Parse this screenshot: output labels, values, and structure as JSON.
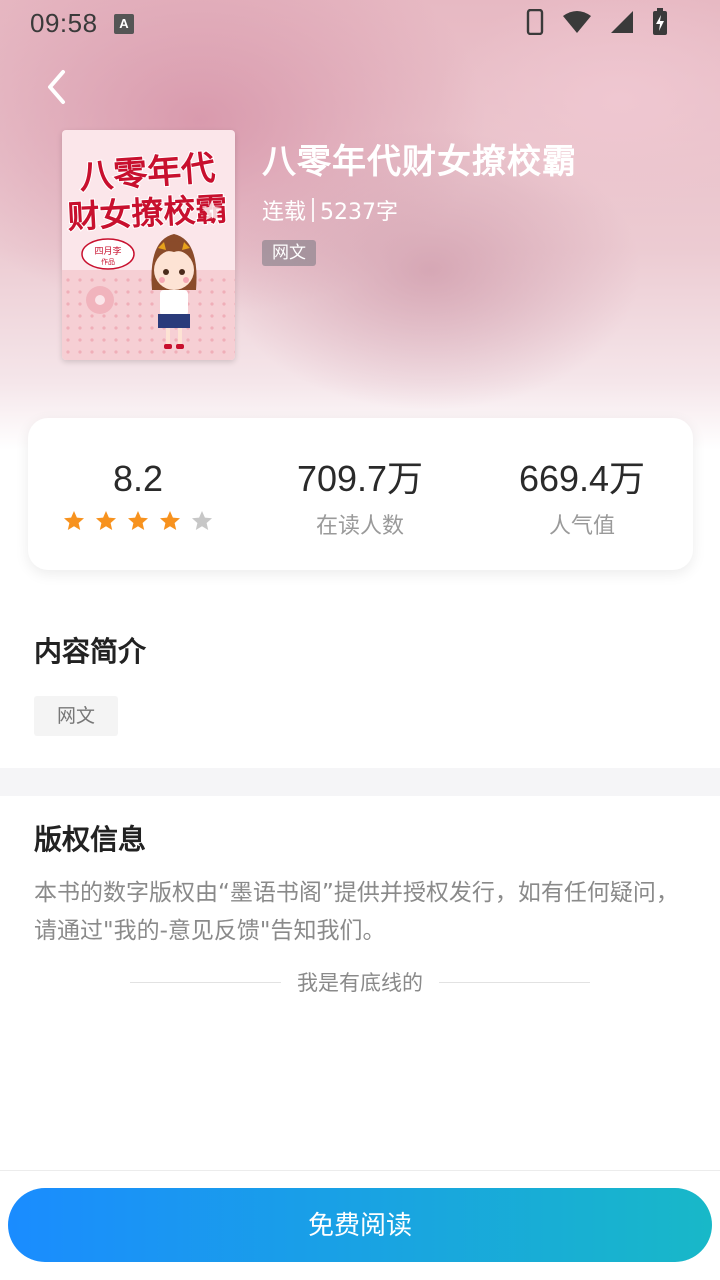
{
  "status_bar": {
    "time": "09:58",
    "notification_glyph": "A"
  },
  "book": {
    "title": "八零年代财女撩校霸",
    "status": "连载",
    "word_count": "5237字",
    "tag": "网文",
    "cover": {
      "title_line1": "八零年代",
      "title_line2": "财女撩校霸",
      "author_badge_line1": "四月李",
      "author_badge_line2": "作品"
    }
  },
  "stats": {
    "rating": "8.2",
    "rating_stars": 4,
    "rating_stars_max": 5,
    "readers_value": "709.7万",
    "readers_label": "在读人数",
    "popularity_value": "669.4万",
    "popularity_label": "人气值"
  },
  "intro": {
    "title": "内容简介",
    "tag": "网文"
  },
  "copyright": {
    "title": "版权信息",
    "text": "本书的数字版权由“墨语书阁”提供并授权发行，如有任何疑问，请通过\"我的-意见反馈\"告知我们。",
    "bottom_line": "我是有底线的"
  },
  "actions": {
    "read_button": "免费阅读"
  },
  "colors": {
    "star_active": "#f7921e",
    "star_inactive": "#c7c7c7",
    "button_gradient_start": "#1a8cff",
    "button_gradient_end": "#18b8c8"
  },
  "icons": {
    "back": "chevron-left-icon",
    "phone": "phone-icon",
    "wifi": "wifi-icon",
    "signal": "signal-icon",
    "battery": "battery-charging-icon"
  }
}
